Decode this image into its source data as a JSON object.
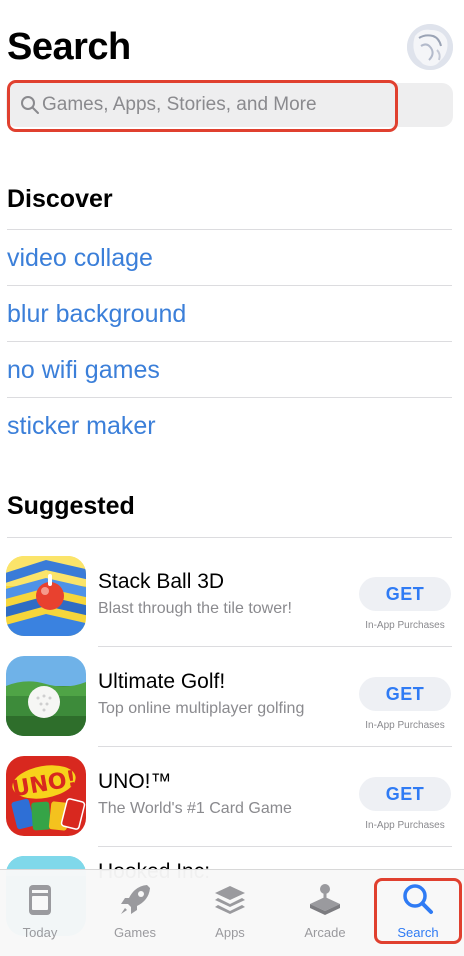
{
  "header": {
    "title": "Search"
  },
  "search": {
    "placeholder": "Games, Apps, Stories, and More"
  },
  "discover": {
    "title": "Discover",
    "items": [
      {
        "label": "video collage"
      },
      {
        "label": "blur background"
      },
      {
        "label": "no wifi games"
      },
      {
        "label": "sticker maker"
      }
    ]
  },
  "suggested": {
    "title": "Suggested",
    "apps": [
      {
        "name": "Stack Ball 3D",
        "subtitle": "Blast through the tile tower!",
        "button": "GET",
        "note": "In-App Purchases"
      },
      {
        "name": "Ultimate Golf!",
        "subtitle": "Top online multiplayer golfing",
        "button": "GET",
        "note": "In-App Purchases"
      },
      {
        "name": "UNO!™",
        "subtitle": "The World's #1 Card Game",
        "button": "GET",
        "note": "In-App Purchases"
      },
      {
        "name": "Hooked Inc:"
      }
    ]
  },
  "tabs": [
    {
      "label": "Today",
      "icon": "today-icon"
    },
    {
      "label": "Games",
      "icon": "rocket-icon"
    },
    {
      "label": "Apps",
      "icon": "apps-stack-icon"
    },
    {
      "label": "Arcade",
      "icon": "joystick-icon"
    },
    {
      "label": "Search",
      "icon": "search-icon",
      "active": true
    }
  ],
  "colors": {
    "accent": "#2f7bf4",
    "link": "#3b7fd9",
    "highlight": "#e0402f"
  }
}
